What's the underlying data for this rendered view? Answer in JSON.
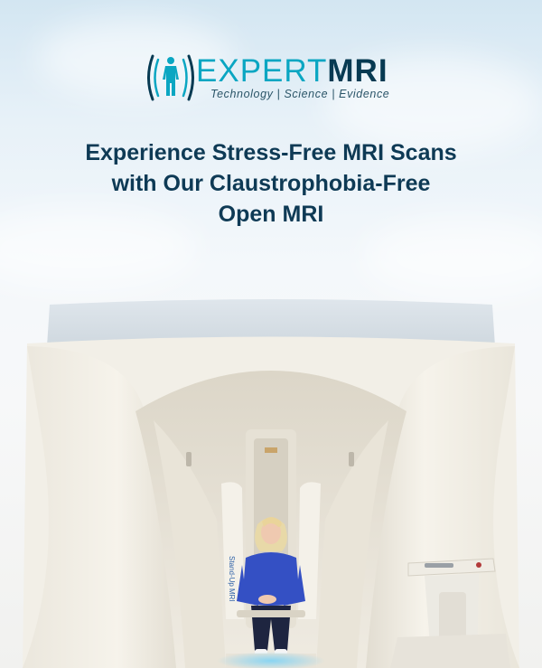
{
  "brand": {
    "name_part1": "EXPERT",
    "name_part2": "MRI",
    "tagline": "Technology | Science | Evidence",
    "icon": "human-figure-icon",
    "colors": {
      "accent": "#0aa6c2",
      "dark": "#073a52",
      "headline": "#0e3a55"
    }
  },
  "headline": {
    "line1": "Experience Stress-Free MRI Scans",
    "line2": "with Our Claustrophobia-Free",
    "line3": "Open MRI"
  },
  "image": {
    "subject": "open-upright-mri-scanner-with-seated-patient",
    "machine_label": "Stand-Up MRI"
  }
}
